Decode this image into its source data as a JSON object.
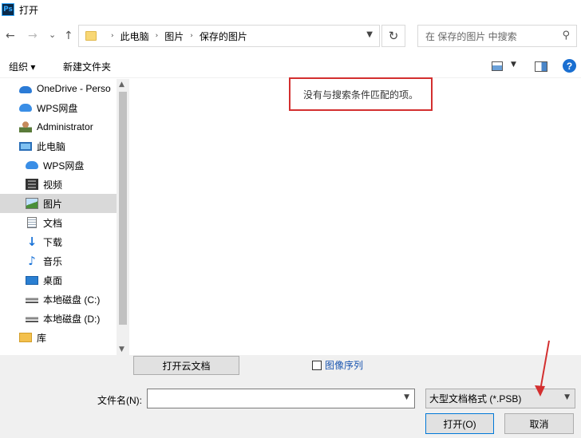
{
  "window": {
    "app_icon_text": "Ps",
    "title": "打开"
  },
  "nav": {
    "back": "←",
    "forward": "→",
    "recent": "⌄",
    "up": "↑",
    "breadcrumb": [
      "此电脑",
      "图片",
      "保存的图片"
    ],
    "refresh": "↻",
    "search_placeholder": "在 保存的图片 中搜索"
  },
  "toolbar": {
    "organize": "组织 ▾",
    "new_folder": "新建文件夹",
    "help": "?"
  },
  "sidebar": {
    "items": [
      {
        "label": "OneDrive - Perso",
        "icon": "onedrive-icon"
      },
      {
        "label": "WPS网盘",
        "icon": "cloud-icon"
      },
      {
        "label": "Administrator",
        "icon": "user-icon"
      },
      {
        "label": "此电脑",
        "icon": "computer-icon"
      },
      {
        "label": "WPS网盘",
        "icon": "cloud-icon"
      },
      {
        "label": "视频",
        "icon": "video-icon"
      },
      {
        "label": "图片",
        "icon": "picture-icon",
        "selected": true
      },
      {
        "label": "文档",
        "icon": "document-icon"
      },
      {
        "label": "下载",
        "icon": "download-icon"
      },
      {
        "label": "音乐",
        "icon": "music-icon"
      },
      {
        "label": "桌面",
        "icon": "desktop-icon"
      },
      {
        "label": "本地磁盘 (C:)",
        "icon": "drive-icon"
      },
      {
        "label": "本地磁盘 (D:)",
        "icon": "drive-icon"
      },
      {
        "label": "库",
        "icon": "library-icon"
      }
    ]
  },
  "content": {
    "empty_message": "没有与搜索条件匹配的项。"
  },
  "bottom": {
    "cloud_docs_button": "打开云文档",
    "image_sequence_label": "图像序列",
    "image_sequence_checked": false,
    "filename_label": "文件名(N):",
    "filename_value": "",
    "filetype_value": "大型文档格式 (*.PSB)",
    "open_button": "打开(O)",
    "cancel_button": "取消"
  },
  "colors": {
    "accent": "#0078d7",
    "highlight_box": "#d32f2f",
    "annotation_arrow": "#d32f2f"
  }
}
